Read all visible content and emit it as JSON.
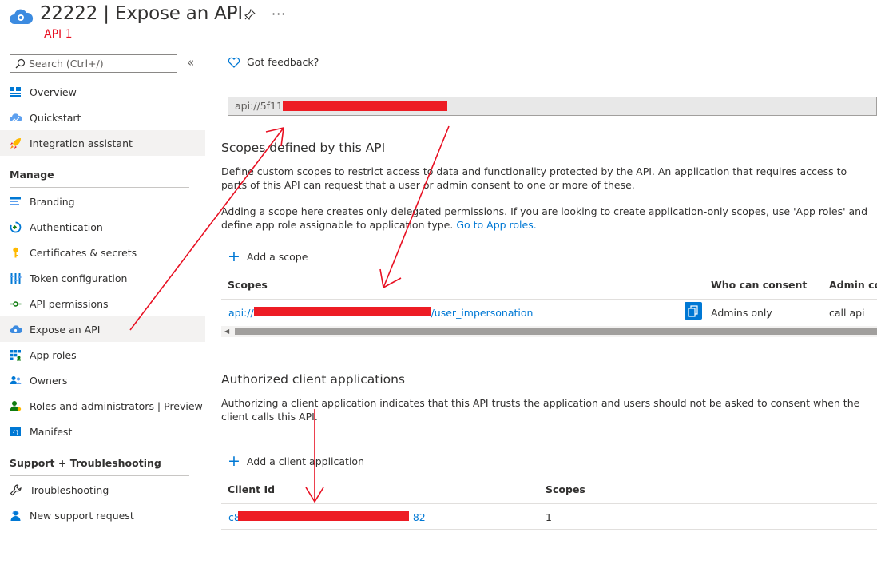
{
  "header": {
    "title": "22222 | Expose an API",
    "subtitle": "API 1",
    "more": "···"
  },
  "sidebar": {
    "search_placeholder": "Search (Ctrl+/)",
    "collapse": "«",
    "items_top": [
      {
        "label": "Overview",
        "icon": "overview-icon"
      },
      {
        "label": "Quickstart",
        "icon": "quickstart-icon"
      },
      {
        "label": "Integration assistant",
        "icon": "rocket-icon"
      }
    ],
    "manage_header": "Manage",
    "items_manage": [
      {
        "label": "Branding",
        "icon": "branding-icon"
      },
      {
        "label": "Authentication",
        "icon": "authentication-icon"
      },
      {
        "label": "Certificates & secrets",
        "icon": "key-icon"
      },
      {
        "label": "Token configuration",
        "icon": "token-icon"
      },
      {
        "label": "API permissions",
        "icon": "permissions-icon"
      },
      {
        "label": "Expose an API",
        "icon": "cloud-icon"
      },
      {
        "label": "App roles",
        "icon": "app-roles-icon"
      },
      {
        "label": "Owners",
        "icon": "owners-icon"
      },
      {
        "label": "Roles and administrators | Preview",
        "icon": "roles-icon"
      },
      {
        "label": "Manifest",
        "icon": "manifest-icon"
      }
    ],
    "support_header": "Support + Troubleshooting",
    "items_support": [
      {
        "label": "Troubleshooting",
        "icon": "wrench-icon"
      },
      {
        "label": "New support request",
        "icon": "support-icon"
      }
    ]
  },
  "main": {
    "feedback": "Got feedback?",
    "app_id_uri": "api://5f11e",
    "scopes_title": "Scopes defined by this API",
    "scopes_desc_1": "Define custom scopes to restrict access to data and functionality protected by the API. An application that requires access to parts of this API can request that a user or admin consent to one or more of these.",
    "scopes_desc_2": "Adding a scope here creates only delegated permissions. If you are looking to create application-only scopes, use 'App roles' and define app role assignable to application type.",
    "go_to_app_roles": "Go to App roles.",
    "add_scope": "Add a scope",
    "scopes_table": {
      "headers": [
        "Scopes",
        "Who can consent",
        "Admin consent display name"
      ],
      "row": {
        "scope_prefix": "api://5",
        "scope_suffix": "b/user_impersonation",
        "who": "Admins only",
        "admin_name": "call api"
      }
    },
    "clients_title": "Authorized client applications",
    "clients_desc": "Authorizing a client application indicates that this API trusts the application and users should not be asked to consent when the client calls this API.",
    "add_client": "Add a client application",
    "clients_table": {
      "headers": [
        "Client Id",
        "Scopes"
      ],
      "row": {
        "client_prefix": "c8",
        "client_suffix": "82",
        "scopes": "1"
      }
    }
  },
  "colors": {
    "accent": "#0078d4",
    "annotation": "#e81123",
    "redaction": "#ed1c24"
  }
}
